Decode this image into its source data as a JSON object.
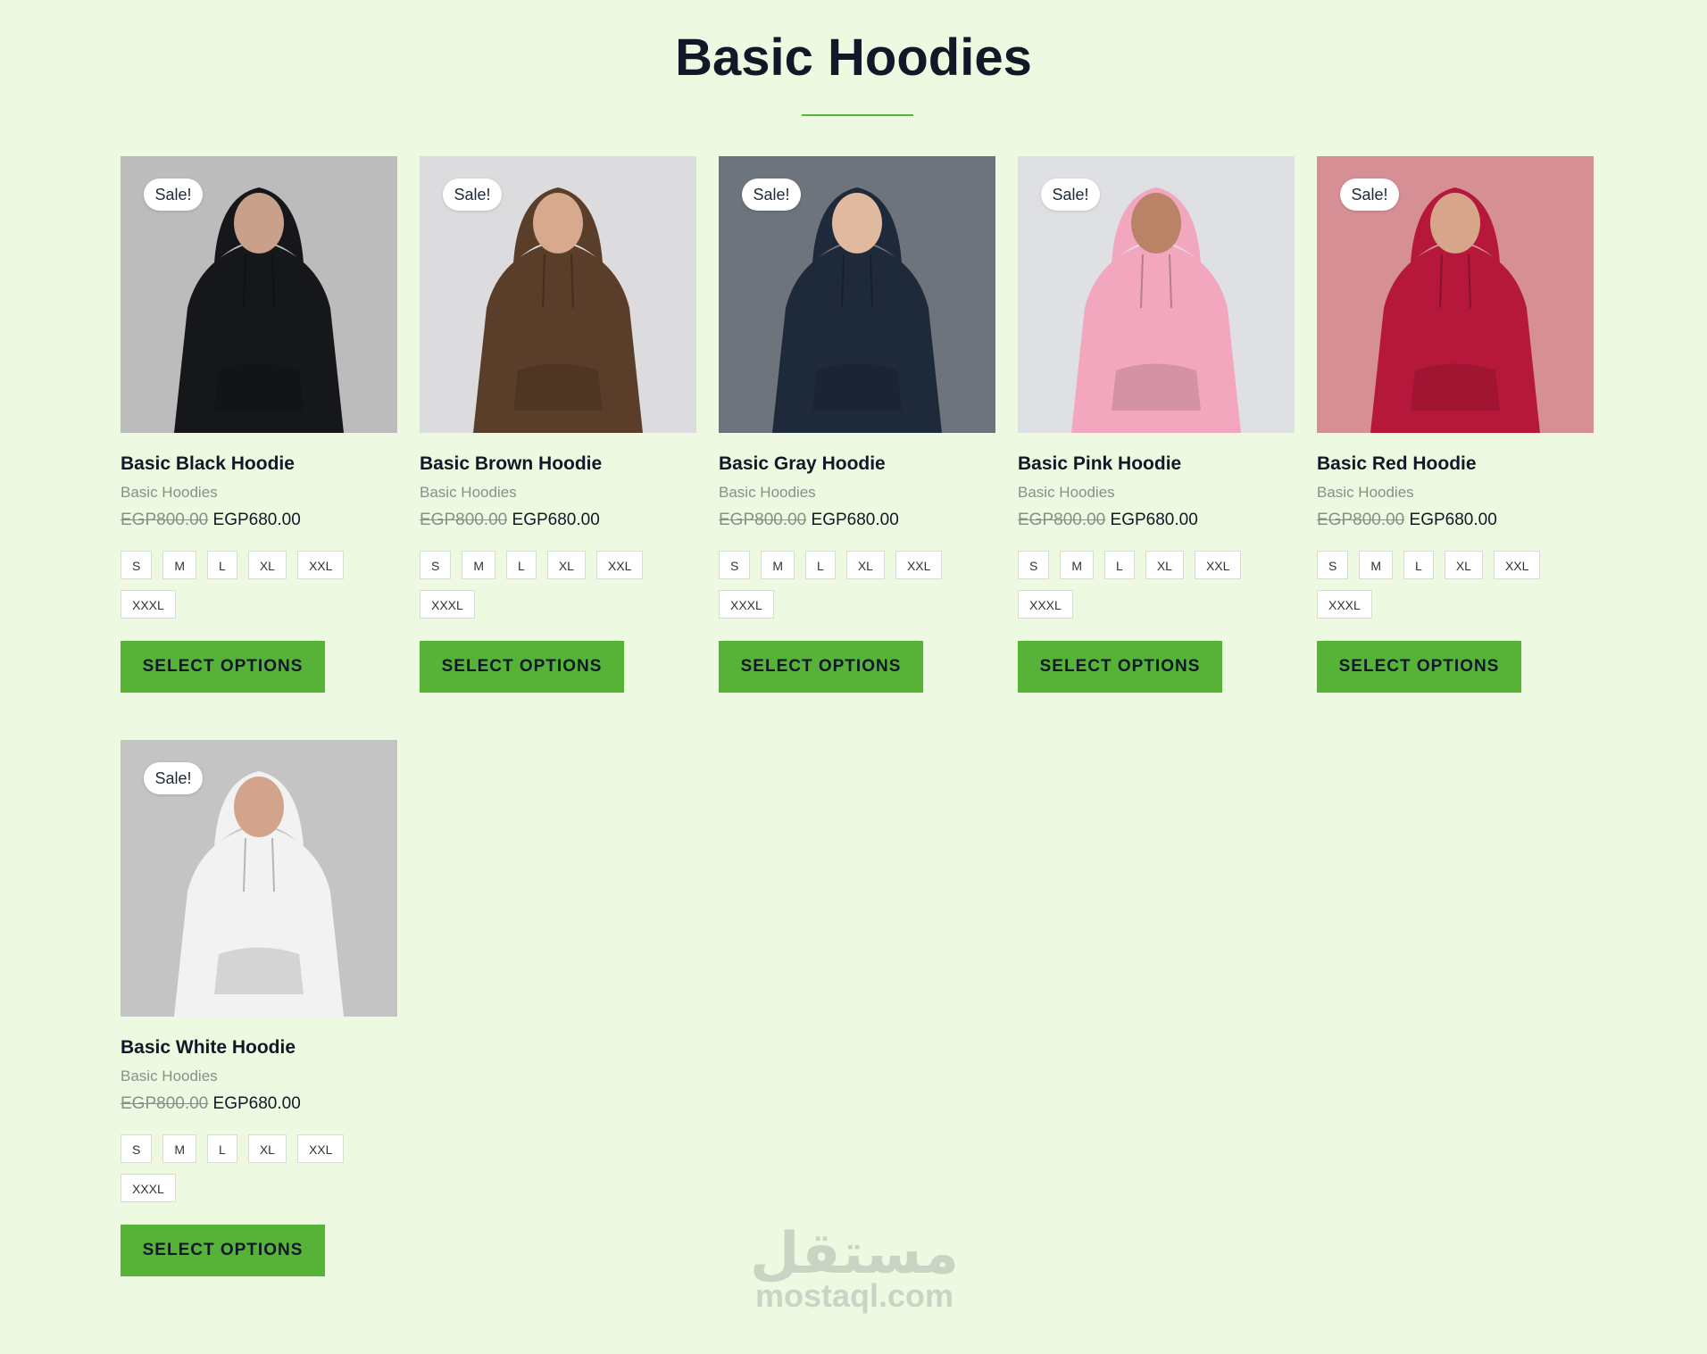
{
  "page": {
    "title": "Basic Hoodies"
  },
  "products": [
    {
      "name": "Basic Black Hoodie",
      "category": "Basic Hoodies",
      "old_price": "EGP800.00",
      "new_price": "EGP680.00",
      "badge": "Sale!",
      "button": "SELECT OPTIONS",
      "color": "#15171a",
      "bg": "#bcbcbc",
      "skin": "#c9a08a"
    },
    {
      "name": "Basic Brown Hoodie",
      "category": "Basic Hoodies",
      "old_price": "EGP800.00",
      "new_price": "EGP680.00",
      "badge": "Sale!",
      "button": "SELECT OPTIONS",
      "color": "#5a3e29",
      "bg": "#dcdcde",
      "skin": "#d7a98d"
    },
    {
      "name": "Basic Gray Hoodie",
      "category": "Basic Hoodies",
      "old_price": "EGP800.00",
      "new_price": "EGP680.00",
      "badge": "Sale!",
      "button": "SELECT OPTIONS",
      "color": "#1e2a3a",
      "bg": "#6d747c",
      "skin": "#e1b99f"
    },
    {
      "name": "Basic Pink Hoodie",
      "category": "Basic Hoodies",
      "old_price": "EGP800.00",
      "new_price": "EGP680.00",
      "badge": "Sale!",
      "button": "SELECT OPTIONS",
      "color": "#f2a7be",
      "bg": "#dfe0e3",
      "skin": "#b88366"
    },
    {
      "name": "Basic Red Hoodie",
      "category": "Basic Hoodies",
      "old_price": "EGP800.00",
      "new_price": "EGP680.00",
      "badge": "Sale!",
      "button": "SELECT OPTIONS",
      "color": "#b5183a",
      "bg": "#d58f95",
      "skin": "#d6a58a"
    },
    {
      "name": "Basic White Hoodie",
      "category": "Basic Hoodies",
      "old_price": "EGP800.00",
      "new_price": "EGP680.00",
      "badge": "Sale!",
      "button": "SELECT OPTIONS",
      "color": "#f2f2f2",
      "bg": "#c4c4c4",
      "skin": "#d1a48b"
    }
  ],
  "sizes": [
    "S",
    "M",
    "L",
    "XL",
    "XXL",
    "XXXL"
  ],
  "watermark": {
    "logo": "مستقل",
    "text": "mostaql.com"
  }
}
